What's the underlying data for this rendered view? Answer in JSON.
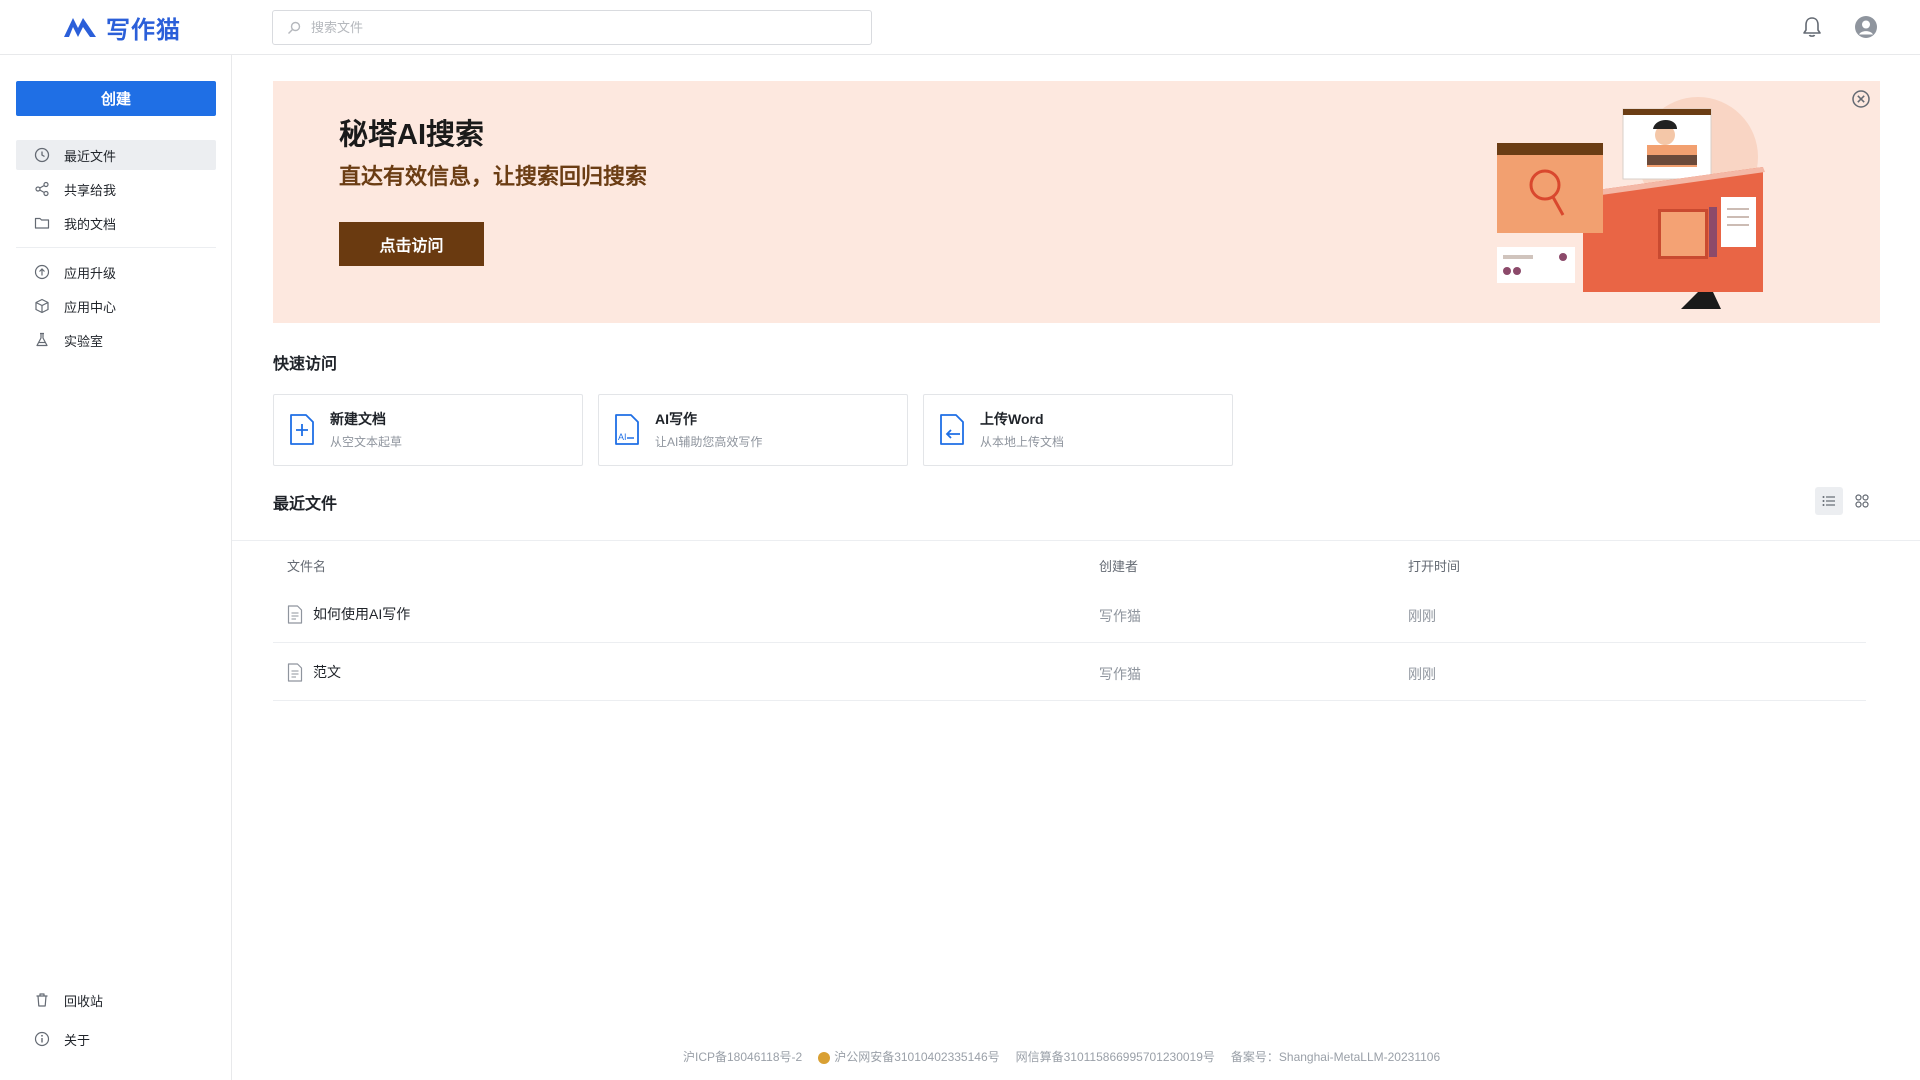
{
  "app": {
    "logo_text": "写作猫",
    "brand_color": "#2b5fd9",
    "accent_color": "#1f6fe5"
  },
  "search": {
    "placeholder": "搜索文件",
    "icon": "search-icon"
  },
  "header": {
    "icons": [
      "bell-icon",
      "user-avatar-icon"
    ]
  },
  "sidebar": {
    "create_label": "创建",
    "items": [
      {
        "label": "最近文件",
        "icon": "clock-icon",
        "active": true
      },
      {
        "label": "共享给我",
        "icon": "share-icon",
        "active": false
      },
      {
        "label": "我的文档",
        "icon": "folder-icon",
        "active": false
      },
      {
        "label": "应用升级",
        "icon": "upgrade-icon",
        "active": false
      },
      {
        "label": "应用中心",
        "icon": "cube-icon",
        "active": false
      },
      {
        "label": "实验室",
        "icon": "flask-icon",
        "active": false
      }
    ],
    "bottom_items": [
      {
        "label": "回收站",
        "icon": "trash-icon"
      },
      {
        "label": "关于",
        "icon": "info-icon"
      }
    ]
  },
  "banner": {
    "title": "秘塔AI搜索",
    "subtitle": "直达有效信息，让搜索回归搜索",
    "button_label": "点击访问",
    "bg_color": "#fde8df"
  },
  "quick_access": {
    "title": "快速访问",
    "cards": [
      {
        "title": "新建文档",
        "desc": "从空文本起草",
        "icon": "new-doc-icon"
      },
      {
        "title": "AI写作",
        "desc": "让AI辅助您高效写作",
        "icon": "ai-doc-icon"
      },
      {
        "title": "上传Word",
        "desc": "从本地上传文档",
        "icon": "upload-doc-icon"
      }
    ]
  },
  "recent": {
    "title": "最近文件",
    "columns": {
      "name": "文件名",
      "creator": "创建者",
      "opened": "打开时间"
    },
    "rows": [
      {
        "name": "如何使用AI写作",
        "creator": "写作猫",
        "opened": "刚刚"
      },
      {
        "name": "范文",
        "creator": "写作猫",
        "opened": "刚刚"
      }
    ]
  },
  "footer": {
    "icp": "沪ICP备18046118号-2",
    "police": "沪公网安备31010402335146号",
    "algo": "网信算备310115866995701230019号",
    "record": "备案号：Shanghai-MetaLLM-20231106"
  }
}
